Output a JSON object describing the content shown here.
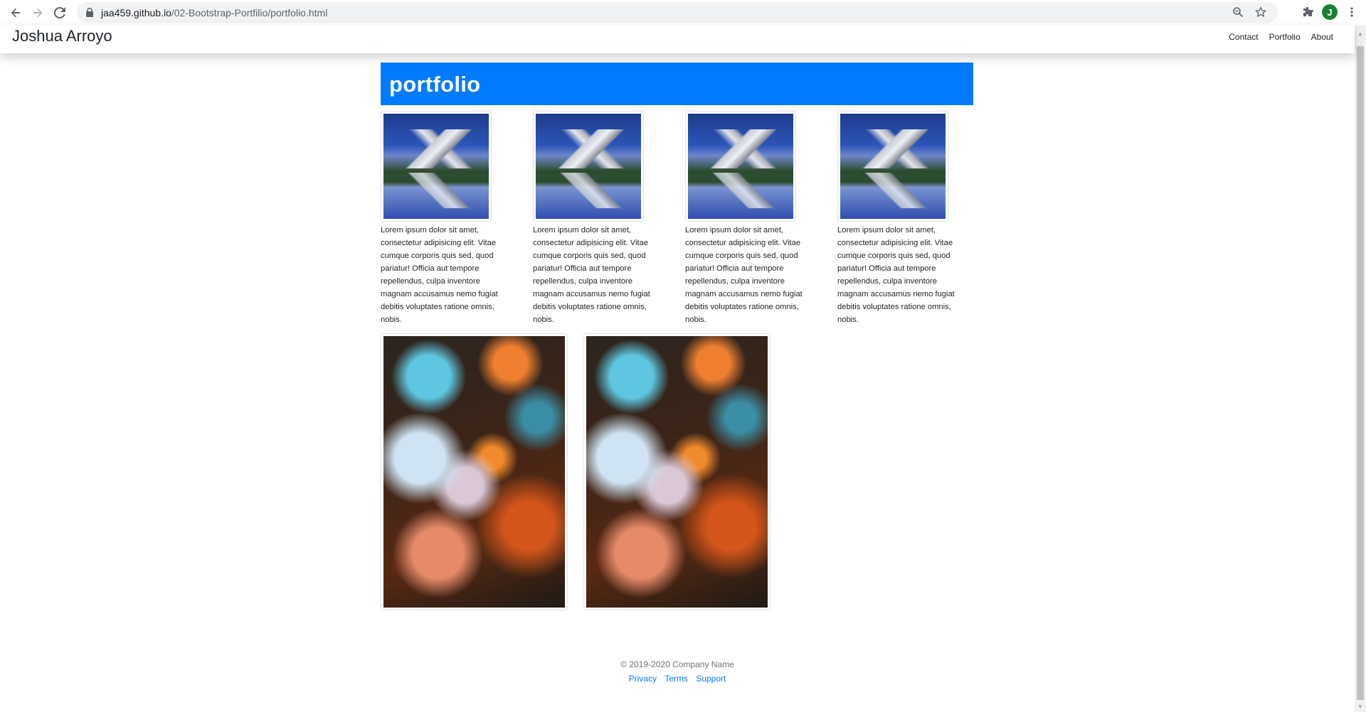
{
  "browser": {
    "url_host": "jaa459.github.io",
    "url_path": "/02-Bootstrap-Portfilio/portfolio.html",
    "profile_initial": "J"
  },
  "navbar": {
    "brand": "Joshua Arroyo",
    "links": [
      "Contact",
      "Portfolio",
      "About"
    ]
  },
  "main": {
    "heading": "portfolio",
    "cards": [
      {
        "image": "mountain-lake-image",
        "text": "Lorem ipsum dolor sit amet, consectetur adipisicing elit. Vitae cumque corporis quis sed, quod pariatur! Officia aut tempore repellendus, culpa inventore magnam accusamus nemo fugiat debitis voluptates ratione omnis, nobis."
      },
      {
        "image": "mountain-lake-image",
        "text": "Lorem ipsum dolor sit amet, consectetur adipisicing elit. Vitae cumque corporis quis sed, quod pariatur! Officia aut tempore repellendus, culpa inventore magnam accusamus nemo fugiat debitis voluptates ratione omnis, nobis."
      },
      {
        "image": "mountain-lake-image",
        "text": "Lorem ipsum dolor sit amet, consectetur adipisicing elit. Vitae cumque corporis quis sed, quod pariatur! Officia aut tempore repellendus, culpa inventore magnam accusamus nemo fugiat debitis voluptates ratione omnis, nobis."
      },
      {
        "image": "mountain-lake-image",
        "text": "Lorem ipsum dolor sit amet, consectetur adipisicing elit. Vitae cumque corporis quis sed, quod pariatur! Officia aut tempore repellendus, culpa inventore magnam accusamus nemo fugiat debitis voluptates ratione omnis, nobis."
      }
    ],
    "tall_images": [
      "blossom-image",
      "blossom-image"
    ]
  },
  "footer": {
    "copyright": "© 2019-2020 Company Name",
    "links": [
      "Privacy",
      "Terms",
      "Support"
    ]
  }
}
